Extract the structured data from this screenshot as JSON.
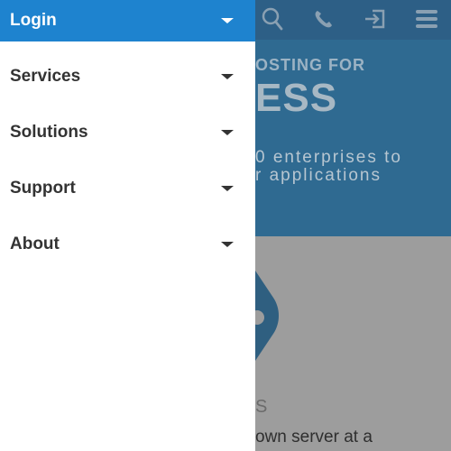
{
  "drawer": {
    "items": [
      {
        "label": "Login",
        "active": true
      },
      {
        "label": "Services",
        "active": false
      },
      {
        "label": "Solutions",
        "active": false
      },
      {
        "label": "Support",
        "active": false
      },
      {
        "label": "About",
        "active": false
      }
    ]
  },
  "background": {
    "hero_kicker": "OSTING FOR",
    "hero_big": "ESS",
    "hero_sub_line1": "0 enterprises to",
    "hero_sub_line2": "r applications",
    "lower_fragment": "S",
    "lower_line": "own server at a"
  },
  "toolbar": {
    "icons": [
      "search-icon",
      "phone-icon",
      "login-icon",
      "menu-icon"
    ]
  },
  "colors": {
    "accent": "#1e83cf",
    "hero_bg": "#2f6a91",
    "topbar_bg": "#2d5f86",
    "dim_bg": "#9d9d9d"
  }
}
